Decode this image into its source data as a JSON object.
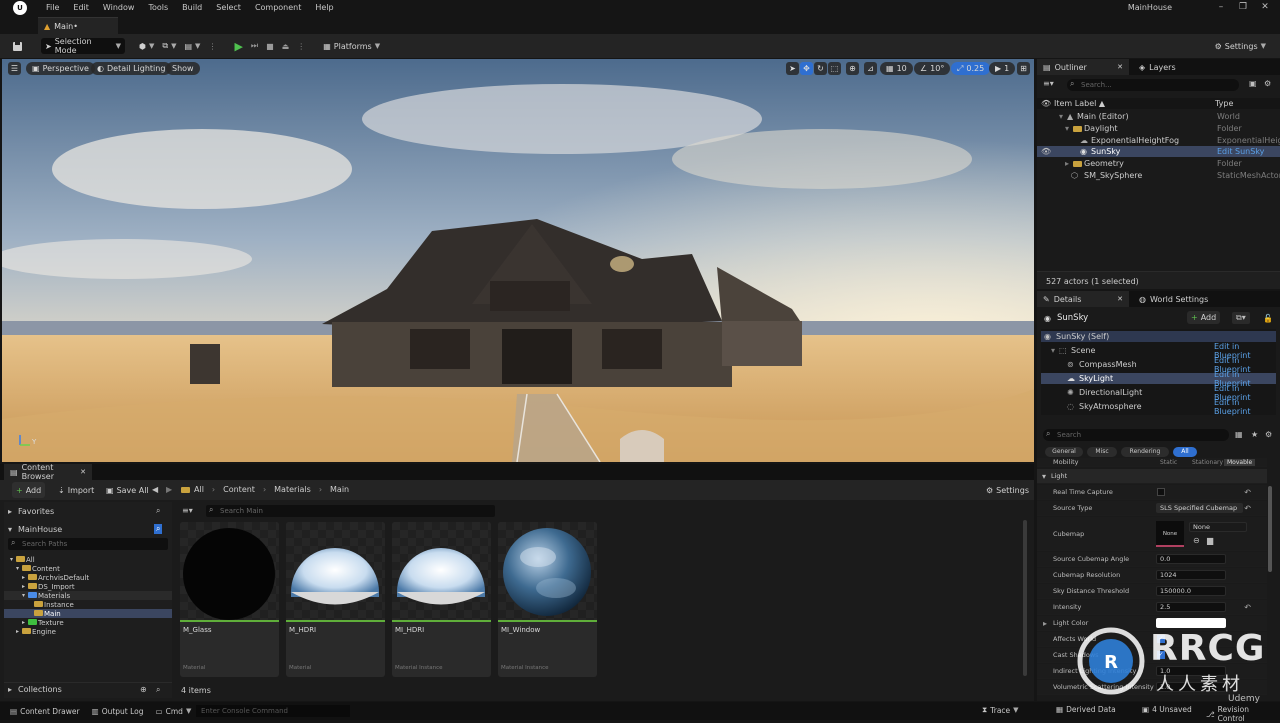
{
  "menubar": {
    "items": [
      "File",
      "Edit",
      "Window",
      "Tools",
      "Build",
      "Select",
      "Component",
      "Help"
    ],
    "window_title": "MainHouse"
  },
  "level_tab": {
    "label": "Main•"
  },
  "toolbar": {
    "selection_mode": "Selection Mode",
    "platforms": "Platforms",
    "settings": "Settings"
  },
  "viewport": {
    "perspective": "Perspective",
    "lighting": "Detail Lighting",
    "show": "Show",
    "grid_snap": "10",
    "rot_snap": "10°",
    "scale_snap": "0.25",
    "camera_speed": "1",
    "axis_label": "Y"
  },
  "outliner": {
    "tab": "Outliner",
    "layers_tab": "Layers",
    "search_placeholder": "Search...",
    "col_label": "Item Label ▲",
    "col_type": "Type",
    "rows": [
      {
        "label": "Main (Editor)",
        "type": "World"
      },
      {
        "label": "Daylight",
        "type": "Folder"
      },
      {
        "label": "ExponentialHeightFog",
        "type": "ExponentialHeig"
      },
      {
        "label": "SunSky",
        "type": "Edit SunSky"
      },
      {
        "label": "Geometry",
        "type": "Folder"
      },
      {
        "label": "SM_SkySphere",
        "type": "StaticMeshActor"
      }
    ],
    "status": "527 actors (1 selected)"
  },
  "details": {
    "tab": "Details",
    "world_settings_tab": "World Settings",
    "actor_name": "SunSky",
    "add_label": "Add",
    "components": [
      {
        "label": "SunSky (Self)",
        "action": ""
      },
      {
        "label": "Scene",
        "action": "Edit in Blueprint"
      },
      {
        "label": "CompassMesh",
        "action": "Edit in Blueprint"
      },
      {
        "label": "SkyLight",
        "action": "Edit in Blueprint"
      },
      {
        "label": "DirectionalLight",
        "action": "Edit in Blueprint"
      },
      {
        "label": "SkyAtmosphere",
        "action": "Edit in Blueprint"
      }
    ],
    "search_placeholder": "Search",
    "categories": [
      "General",
      "Misc",
      "Rendering",
      "All"
    ],
    "mobility_label": "Mobility",
    "mobility_options": [
      "Static",
      "Stationary",
      "Movable"
    ],
    "section": "Light",
    "props": {
      "real_time_capture": "Real Time Capture",
      "source_type_label": "Source Type",
      "source_type_value": "SLS Specified Cubemap",
      "cubemap_label": "Cubemap",
      "cubemap_thumb": "None",
      "cubemap_value": "None",
      "angle_label": "Source Cubemap Angle",
      "angle_value": "0.0",
      "resolution_label": "Cubemap Resolution",
      "resolution_value": "1024",
      "distance_label": "Sky Distance Threshold",
      "distance_value": "150000.0",
      "intensity_label": "Intensity",
      "intensity_value": "2.5",
      "color_label": "Light Color",
      "affects_label": "Affects World",
      "cast_label": "Cast Shadows",
      "indirect_label": "Indirect Lighting Intensity",
      "indirect_value": "1.0",
      "volumetric_label": "Volumetric Scattering Intensity",
      "volumetric_value": "1.0"
    }
  },
  "content_browser": {
    "tab": "Content Browser",
    "add": "Add",
    "import": "Import",
    "save_all": "Save All",
    "breadcrumb": [
      "All",
      "Content",
      "Materials",
      "Main"
    ],
    "settings": "Settings",
    "favorites": "Favorites",
    "project": "MainHouse",
    "search_paths": "Search Paths",
    "search_main": "Search Main",
    "tree": [
      "All",
      "Content",
      "ArchvisDefault",
      "DS_Import",
      "Materials",
      "Instance",
      "Main",
      "Texture",
      "Engine"
    ],
    "collections": "Collections",
    "assets": [
      {
        "name": "M_Glass",
        "type": "Material"
      },
      {
        "name": "M_HDRI",
        "type": "Material"
      },
      {
        "name": "MI_HDRI",
        "type": "Material Instance"
      },
      {
        "name": "MI_Window",
        "type": "Material Instance"
      }
    ],
    "count": "4 items"
  },
  "statusbar": {
    "content_drawer": "Content Drawer",
    "output_log": "Output Log",
    "cmd": "Cmd",
    "console_placeholder": "Enter Console Command",
    "trace": "Trace",
    "derived_data": "Derived Data",
    "unsaved": "4 Unsaved",
    "revision": "Revision Control"
  },
  "watermark": {
    "text": "RRCG",
    "sub": "人人素材",
    "udemy": "Udemy"
  }
}
